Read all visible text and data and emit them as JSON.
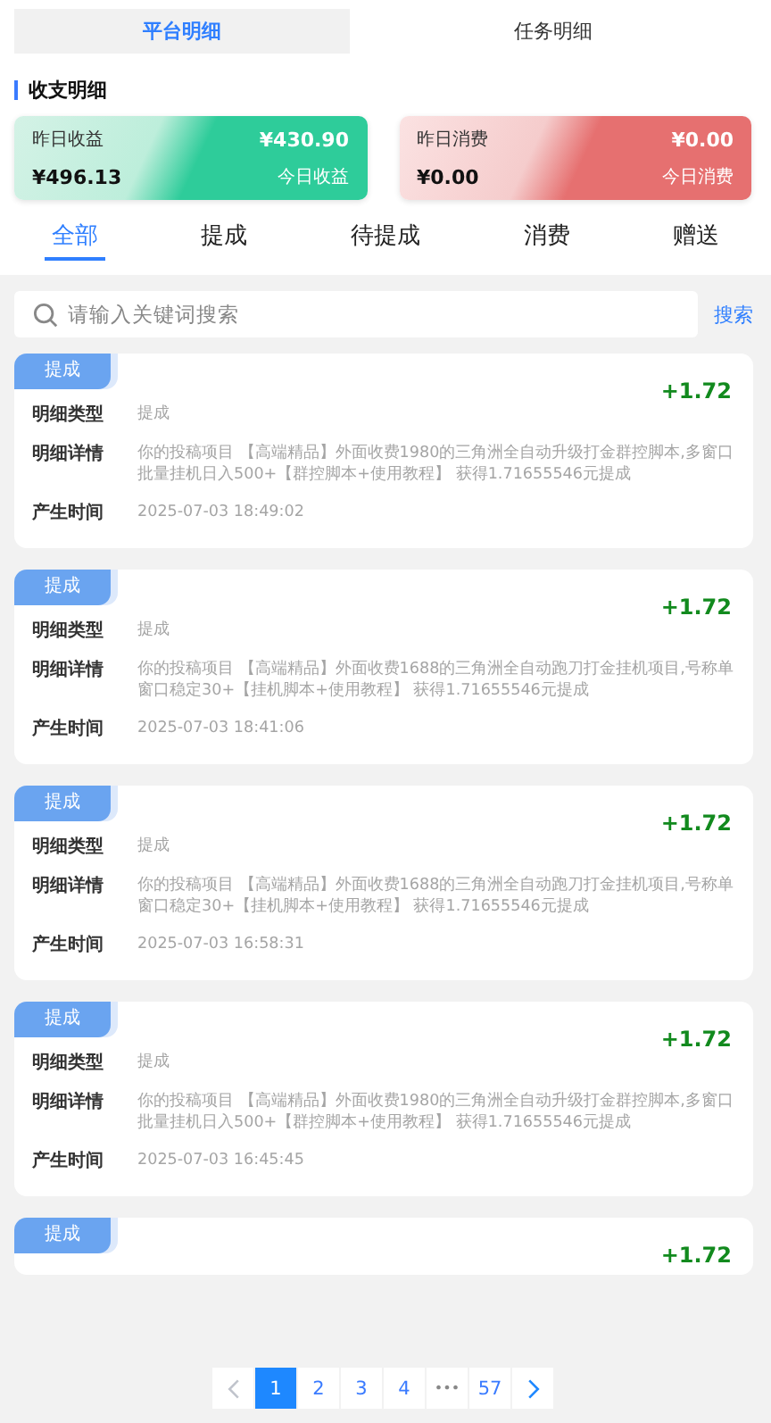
{
  "top_tabs": [
    {
      "label": "平台明细",
      "selected": true
    },
    {
      "label": "任务明细",
      "selected": false
    }
  ],
  "section_title": "收支明细",
  "summary_cards": [
    {
      "kind": "income",
      "yesterday_label": "昨日收益",
      "yesterday_value": "¥430.90",
      "today_value": "¥496.13",
      "today_label": "今日收益"
    },
    {
      "kind": "expense",
      "yesterday_label": "昨日消费",
      "yesterday_value": "¥0.00",
      "today_value": "¥0.00",
      "today_label": "今日消费"
    }
  ],
  "filter_tabs": [
    {
      "label": "全部",
      "selected": true
    },
    {
      "label": "提成",
      "selected": false
    },
    {
      "label": "待提成",
      "selected": false
    },
    {
      "label": "消费",
      "selected": false
    },
    {
      "label": "赠送",
      "selected": false
    }
  ],
  "search": {
    "placeholder": "请输入关键词搜索",
    "button": "搜索"
  },
  "records": [
    {
      "tag": "提成",
      "amount": "+1.72",
      "rows": [
        {
          "label": "明细类型",
          "value": "提成"
        },
        {
          "label": "明细详情",
          "value": "你的投稿项目 【高端精品】外面收费1980的三角洲全自动升级打金群控脚本,多窗口批量挂机日入500+【群控脚本+使用教程】 获得1.71655546元提成"
        },
        {
          "label": "产生时间",
          "value": "2025-07-03 18:49:02"
        }
      ]
    },
    {
      "tag": "提成",
      "amount": "+1.72",
      "rows": [
        {
          "label": "明细类型",
          "value": "提成"
        },
        {
          "label": "明细详情",
          "value": "你的投稿项目 【高端精品】外面收费1688的三角洲全自动跑刀打金挂机项目,号称单窗口稳定30+【挂机脚本+使用教程】 获得1.71655546元提成"
        },
        {
          "label": "产生时间",
          "value": "2025-07-03 18:41:06"
        }
      ]
    },
    {
      "tag": "提成",
      "amount": "+1.72",
      "rows": [
        {
          "label": "明细类型",
          "value": "提成"
        },
        {
          "label": "明细详情",
          "value": "你的投稿项目 【高端精品】外面收费1688的三角洲全自动跑刀打金挂机项目,号称单窗口稳定30+【挂机脚本+使用教程】 获得1.71655546元提成"
        },
        {
          "label": "产生时间",
          "value": "2025-07-03 16:58:31"
        }
      ]
    },
    {
      "tag": "提成",
      "amount": "+1.72",
      "rows": [
        {
          "label": "明细类型",
          "value": "提成"
        },
        {
          "label": "明细详情",
          "value": "你的投稿项目 【高端精品】外面收费1980的三角洲全自动升级打金群控脚本,多窗口批量挂机日入500+【群控脚本+使用教程】 获得1.71655546元提成"
        },
        {
          "label": "产生时间",
          "value": "2025-07-03 16:45:45"
        }
      ]
    },
    {
      "tag": "提成",
      "amount": "+1.72"
    }
  ],
  "pagination": {
    "prev_disabled": true,
    "next_disabled": false,
    "pages": [
      {
        "label": "1",
        "selected": true
      },
      {
        "label": "2",
        "selected": false
      },
      {
        "label": "3",
        "selected": false
      },
      {
        "label": "4",
        "selected": false
      },
      {
        "label": "•••",
        "selected": false,
        "kind": "ellipsis"
      },
      {
        "label": "57",
        "selected": false
      }
    ]
  }
}
